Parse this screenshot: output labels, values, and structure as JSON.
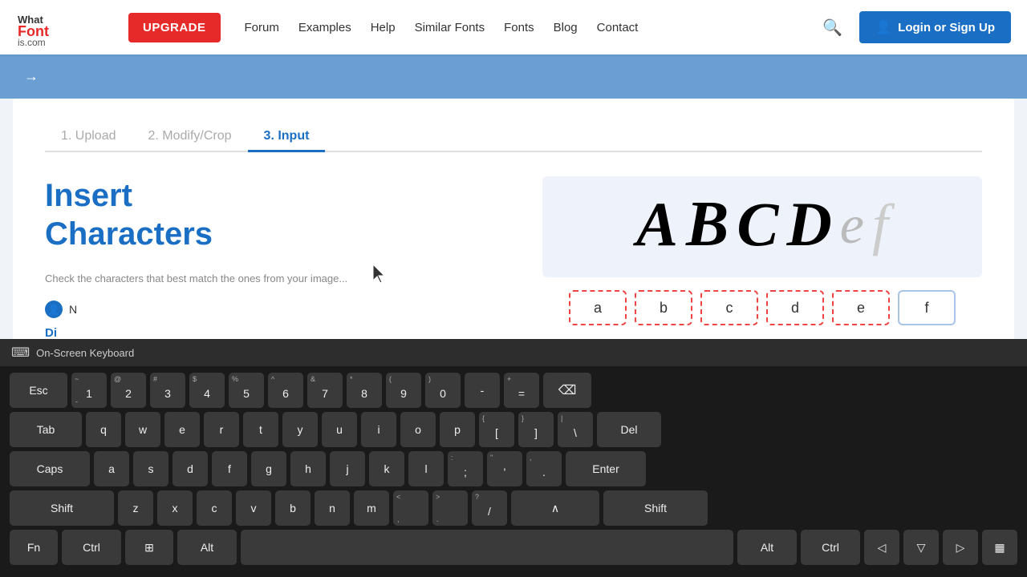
{
  "header": {
    "logo_line1": "What",
    "logo_font": "Font",
    "logo_line2": "is.com",
    "upgrade_label": "UPGRADE",
    "nav": [
      "Forum",
      "Examples",
      "Help",
      "Similar Fonts",
      "Fonts",
      "Blog",
      "Contact"
    ],
    "login_label": "Login or Sign Up"
  },
  "tabs": [
    {
      "label": "1. Upload",
      "active": false
    },
    {
      "label": "2. Modify/Crop",
      "active": false
    },
    {
      "label": "3. Input",
      "active": true
    }
  ],
  "left": {
    "title_line1": "Insert",
    "title_line2": "Characters",
    "check_text": "Chec",
    "user_text": "N",
    "di_text": "Di"
  },
  "preview": {
    "chars": [
      "A",
      "B",
      "C",
      "D",
      "e",
      "f"
    ],
    "inputs": [
      "a",
      "b",
      "c",
      "d",
      "e",
      "f"
    ]
  },
  "osk": {
    "title": "On-Screen Keyboard",
    "rows": [
      {
        "keys": [
          {
            "label": "Esc",
            "width": "wide-1"
          },
          {
            "label": "1",
            "sub": "~",
            "sub2": "-",
            "width": ""
          },
          {
            "label": "2",
            "sub": "@",
            "width": ""
          },
          {
            "label": "3",
            "sub": "#",
            "width": ""
          },
          {
            "label": "4",
            "sub": "$",
            "width": ""
          },
          {
            "label": "5",
            "sub": "%",
            "width": ""
          },
          {
            "label": "6",
            "sub": "^",
            "width": ""
          },
          {
            "label": "7",
            "sub": "&",
            "width": ""
          },
          {
            "label": "8",
            "sub": "*",
            "width": ""
          },
          {
            "label": "9",
            "sub": "(",
            "width": ""
          },
          {
            "label": "0",
            "sub": ")",
            "width": ""
          },
          {
            "label": "-",
            "sub": "_",
            "width": ""
          },
          {
            "label": "=",
            "sub": "+",
            "width": ""
          },
          {
            "label": "⌫",
            "width": "wide-backspace",
            "icon": true
          }
        ]
      },
      {
        "keys": [
          {
            "label": "Tab",
            "width": "wide-2"
          },
          {
            "label": "q",
            "width": ""
          },
          {
            "label": "w",
            "width": ""
          },
          {
            "label": "e",
            "width": ""
          },
          {
            "label": "r",
            "width": ""
          },
          {
            "label": "t",
            "width": ""
          },
          {
            "label": "y",
            "width": ""
          },
          {
            "label": "u",
            "width": ""
          },
          {
            "label": "i",
            "width": ""
          },
          {
            "label": "o",
            "width": ""
          },
          {
            "label": "p",
            "width": ""
          },
          {
            "label": "{",
            "sub": "[",
            "width": ""
          },
          {
            "label": "}",
            "sub": "]",
            "width": ""
          },
          {
            "label": "|",
            "sub": "\\",
            "width": ""
          },
          {
            "label": "Del",
            "width": "wide-del"
          }
        ]
      },
      {
        "keys": [
          {
            "label": "Caps",
            "width": "wide-caps"
          },
          {
            "label": "a",
            "width": ""
          },
          {
            "label": "s",
            "width": ""
          },
          {
            "label": "d",
            "width": ""
          },
          {
            "label": "f",
            "width": ""
          },
          {
            "label": "g",
            "width": ""
          },
          {
            "label": "h",
            "width": ""
          },
          {
            "label": "j",
            "width": ""
          },
          {
            "label": "k",
            "width": ""
          },
          {
            "label": "l",
            "width": ""
          },
          {
            "label": ":",
            "sub": ";",
            "width": ""
          },
          {
            "label": "\"",
            "sub": "'",
            "width": ""
          },
          {
            "label": ",",
            "sub": ".",
            "width": ""
          },
          {
            "label": "Enter",
            "width": "wide-enter"
          }
        ]
      },
      {
        "keys": [
          {
            "label": "Shift",
            "width": "wide-shift"
          },
          {
            "label": "z",
            "width": ""
          },
          {
            "label": "x",
            "width": ""
          },
          {
            "label": "c",
            "width": ""
          },
          {
            "label": "v",
            "width": ""
          },
          {
            "label": "b",
            "width": ""
          },
          {
            "label": "n",
            "width": ""
          },
          {
            "label": "m",
            "width": ""
          },
          {
            "label": "<",
            "sub": ",",
            "width": ""
          },
          {
            "label": ">",
            "sub": ".",
            "width": ""
          },
          {
            "label": "?",
            "sub": "/",
            "width": ""
          },
          {
            "label": "∧",
            "width": "wide-3"
          },
          {
            "label": "Shift",
            "width": "wide-shift"
          }
        ]
      },
      {
        "keys": [
          {
            "label": "Fn",
            "width": "wide-fn"
          },
          {
            "label": "Ctrl",
            "width": "wide-ctrl"
          },
          {
            "label": "⊞",
            "width": "wide-win"
          },
          {
            "label": "Alt",
            "width": "wide-alt"
          },
          {
            "label": "",
            "width": "spacebar"
          },
          {
            "label": "Alt",
            "width": "wide-alt"
          },
          {
            "label": "Ctrl",
            "width": "wide-ctrl"
          },
          {
            "label": "◁",
            "width": ""
          },
          {
            "label": "▽",
            "width": ""
          },
          {
            "label": "▷",
            "width": ""
          },
          {
            "label": "▦",
            "width": ""
          }
        ]
      }
    ]
  }
}
